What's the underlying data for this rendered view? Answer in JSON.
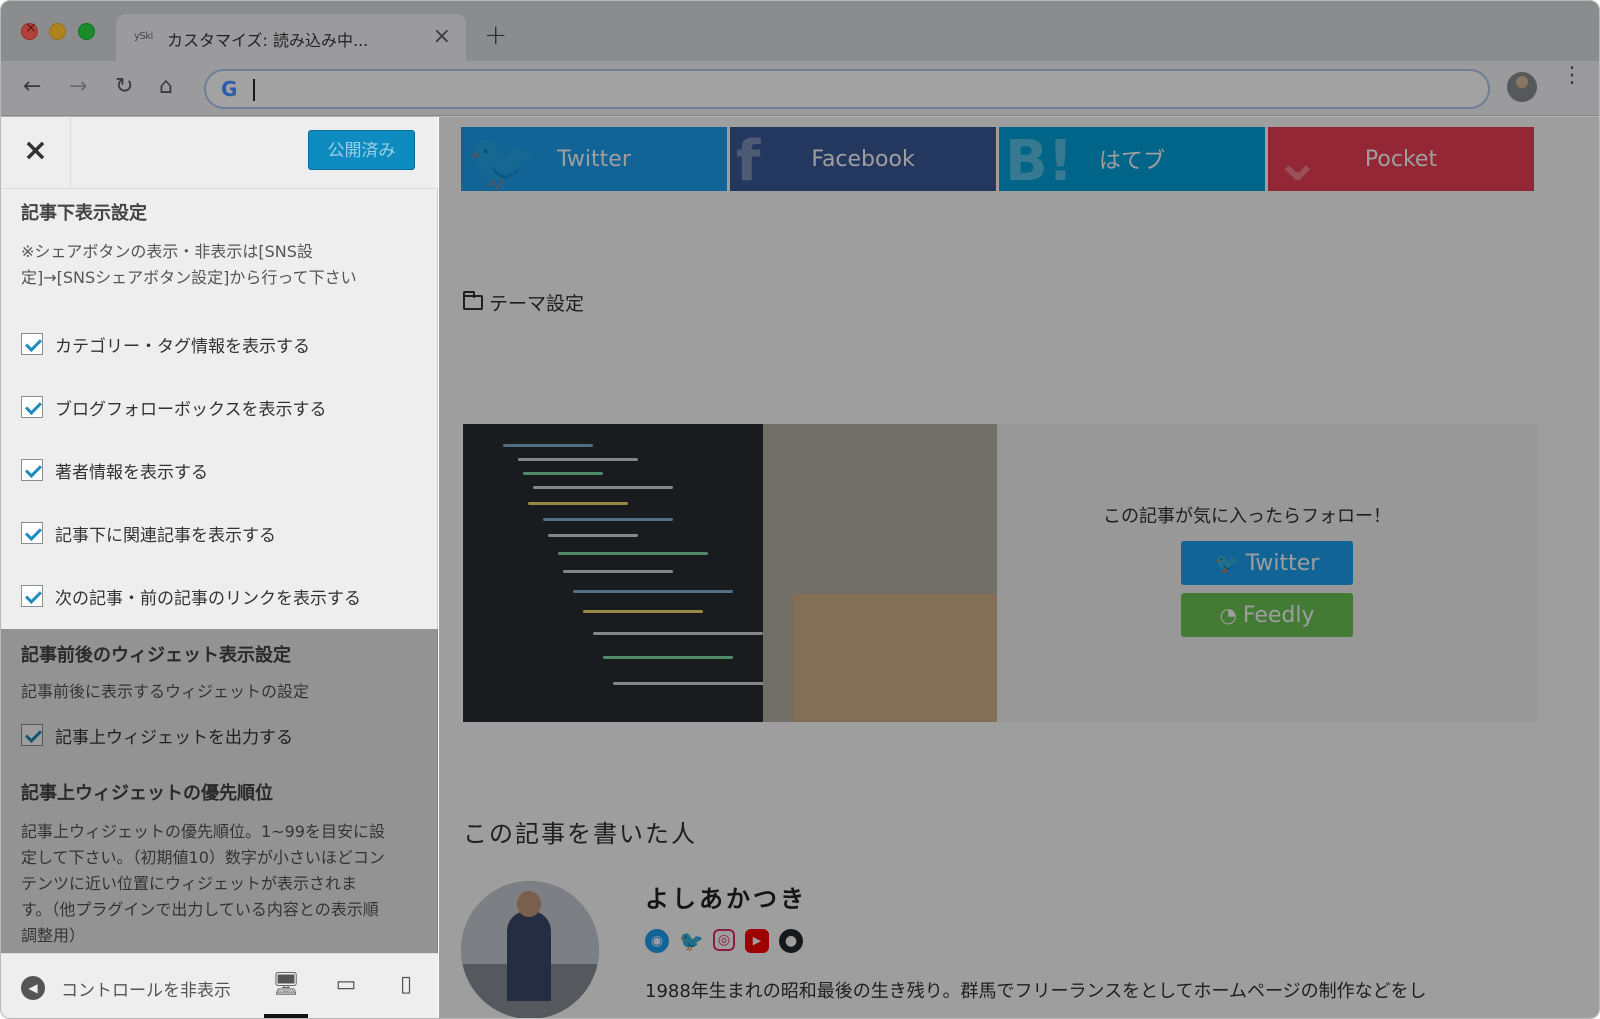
{
  "browser": {
    "tab_favicon_text": "ySki",
    "tab_title": "カスタマイズ: 読み込み中...",
    "tab_close_glyph": "×",
    "new_tab_glyph": "+",
    "omnibox_value": "",
    "google_glyph": "G",
    "back_glyph": "←",
    "forward_glyph": "→",
    "reload_glyph": "↻",
    "home_glyph": "⌂",
    "menu_glyph": "⋮"
  },
  "sidebar": {
    "close_glyph": "×",
    "publish_label": "公開済み",
    "section1": {
      "title": "記事下表示設定",
      "description": "※シェアボタンの表示・非表示は[SNS設定]→[SNSシェアボタン設定]から行って下さい",
      "checkboxes": [
        {
          "label": "カテゴリー・タグ情報を表示する",
          "checked": true
        },
        {
          "label": "ブログフォローボックスを表示する",
          "checked": true
        },
        {
          "label": "著者情報を表示する",
          "checked": true
        },
        {
          "label": "記事下に関連記事を表示する",
          "checked": true
        },
        {
          "label": "次の記事・前の記事のリンクを表示する",
          "checked": true
        }
      ]
    },
    "section2": {
      "title": "記事前後のウィジェット表示設定",
      "description": "記事前後に表示するウィジェットの設定",
      "checkbox": {
        "label": "記事上ウィジェットを出力する",
        "checked": true
      }
    },
    "section3": {
      "title": "記事上ウィジェットの優先順位",
      "description": "記事上ウィジェットの優先順位。1~99を目安に設定して下さい。（初期値10）数字が小さいほどコンテンツに近い位置にウィジェットが表示されます。（他プラグインで出力している内容との表示順調整用）"
    },
    "footer": {
      "collapse_label": "コントロールを非表示",
      "collapse_glyph": "◀",
      "desktop_glyph": "🖥",
      "tablet_glyph": "▭",
      "mobile_glyph": "▯"
    }
  },
  "preview": {
    "share_buttons": [
      {
        "label": "Twitter",
        "icon": "twitter-bird-icon",
        "color": "#1da1f2",
        "bg_glyph": "🐦"
      },
      {
        "label": "Facebook",
        "icon": "facebook-icon",
        "color": "#3b5998",
        "bg_glyph": "f"
      },
      {
        "label": "はてブ",
        "icon": "hatena-icon",
        "color": "#00a4de",
        "bg_glyph": "B!"
      },
      {
        "label": "Pocket",
        "icon": "pocket-icon",
        "color": "#ef4056",
        "bg_glyph": "⌄"
      }
    ],
    "category": "テーマ設定",
    "follow_text": "この記事が気に入ったらフォロー！",
    "follow_twitter": "Twitter",
    "follow_feedly": "Feedly",
    "author_heading": "この記事を書いた人",
    "author_name": "よしあかつき",
    "author_bio": "1988年生まれの昭和最後の生き残り。群馬でフリーランスをとしてホームページの制作などをし"
  }
}
